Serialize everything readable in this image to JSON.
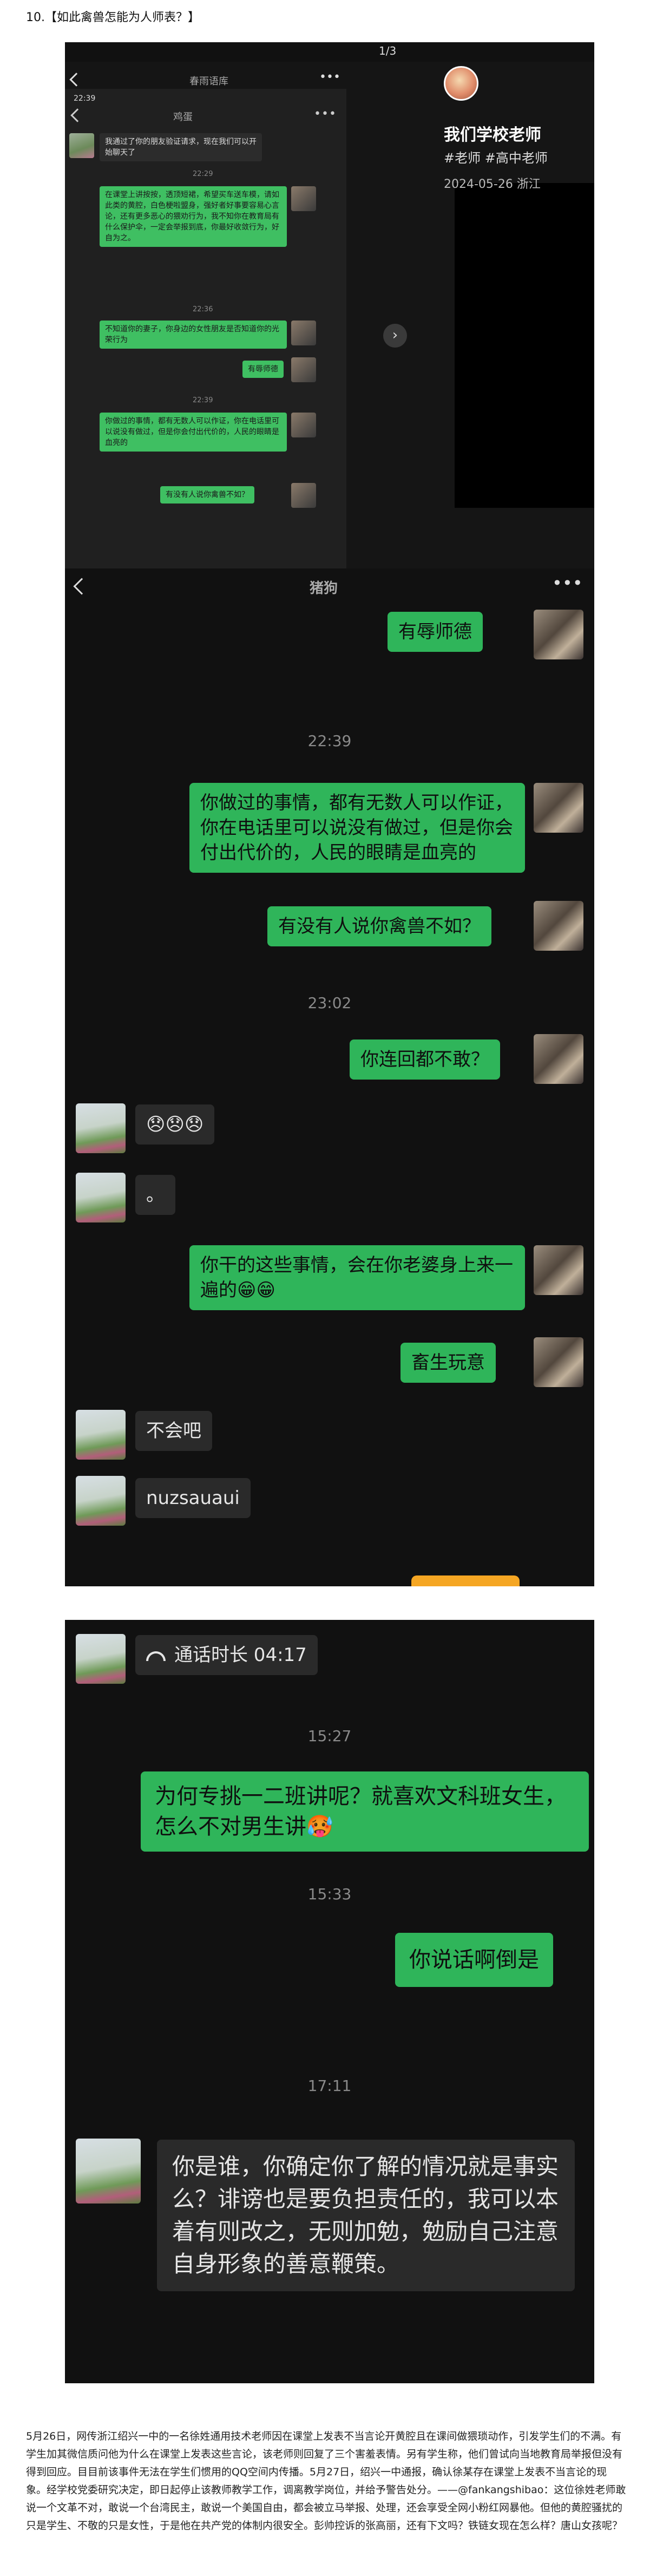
{
  "heading": "10.【如此禽兽怎能为人师表？】",
  "screenshot1": {
    "page_counter": "1/3",
    "phone_time": "22:39",
    "chat_title": "鸡蛋",
    "top_title": "春雨语库",
    "messages": [
      {
        "side": "left",
        "text": "我通过了你的朋友验证请求，现在我们可以开始聊天了"
      },
      {
        "time": "22:29"
      },
      {
        "side": "right",
        "text": "在课堂上讲按按，透顶短裙，希望买车送车模，请如此类的黄腔，白色梗啦盟身，强好者好事要容易心言论，还有更多恶心的猥劝行为，我不知你在教育局有什么保护伞，一定会举报到底，你最好收敛行为，好自为之。"
      },
      {
        "time": "22:36"
      },
      {
        "side": "right",
        "text": "不知道你的妻子，你身边的女性朋友是否知道你的光荣行为"
      },
      {
        "side": "right",
        "text": "有辱师德"
      },
      {
        "time": "22:39"
      },
      {
        "side": "right",
        "text": "你做过的事情，都有无数人可以作证，你在电话里可以说没有做过，但是你会付出代价的，人民的眼睛是血亮的"
      },
      {
        "side": "right",
        "text": "有没有人说你禽兽不如？"
      }
    ],
    "author": {
      "name": "我们学校老师",
      "tags": "#老师  #高中老师",
      "date": "2024-05-26 浙江"
    }
  },
  "screenshot2": {
    "title": "猪狗",
    "messages": [
      {
        "side": "right",
        "text": "有辱师德"
      },
      {
        "time": "22:39"
      },
      {
        "side": "right",
        "text": "你做过的事情，都有无数人可以作证，你在电话里可以说没有做过，但是你会付出代价的，人民的眼睛是血亮的"
      },
      {
        "side": "right",
        "text": "有没有人说你禽兽不如？"
      },
      {
        "time": "23:02"
      },
      {
        "side": "right",
        "text": "你连回都不敢？"
      },
      {
        "side": "left",
        "text": "😞😞😞"
      },
      {
        "side": "left",
        "text": "。"
      },
      {
        "side": "right",
        "text": "你干的这些事情，会在你老婆身上来一遍的😁😁"
      },
      {
        "side": "right",
        "text": "畜生玩意"
      },
      {
        "side": "left",
        "text": "不会吧"
      },
      {
        "side": "left",
        "text": "nuzsauaui"
      }
    ]
  },
  "screenshot3": {
    "messages": [
      {
        "side": "left",
        "text": "通话时长 04:17",
        "type": "call"
      },
      {
        "time": "15:27"
      },
      {
        "side": "right",
        "text": "为何专挑一二班讲呢？就喜欢文科班女生，怎么不对男生讲🥵"
      },
      {
        "time": "15:33"
      },
      {
        "side": "right",
        "text": "你说话啊倒是"
      },
      {
        "time": "17:11"
      },
      {
        "side": "left",
        "text": "你是谁，你确定你了解的情况就是事实么？诽谤也是要负担责任的，我可以本着有则改之，无则加勉，勉励自己注意自身形象的善意鞭策。"
      }
    ]
  },
  "footer": "5月26日，网传浙江绍兴一中的一名徐姓通用技术老师因在课堂上发表不当言论开黄腔且在课间做猥琐动作，引发学生们的不满。有学生加其微信质问他为什么在课堂上发表这些言论，该老师则回复了三个害羞表情。另有学生称，他们曾试向当地教育局举报但没有得到回应。目目前该事件无法在学生们惯用的QQ空间内传播。5月27日，绍兴一中通报，确认徐某存在课堂上发表不当言论的现象。经学校党委研究决定，即日起停止该教师教学工作，调离教学岗位，并给予警告处分。——@fankangshibao：这位徐姓老师敢说一个文革不对，敢说一个台湾民主，敢说一个美国自由，都会被立马举报、处理，还会享受全网小粉红网暴他。但他的黄腔骚扰的只是学生、不敬的只是女性，于是他在共产党的体制内很安全。彭帅控诉的张高丽，还有下文吗？铁链女现在怎么样？唐山女孩呢？"
}
